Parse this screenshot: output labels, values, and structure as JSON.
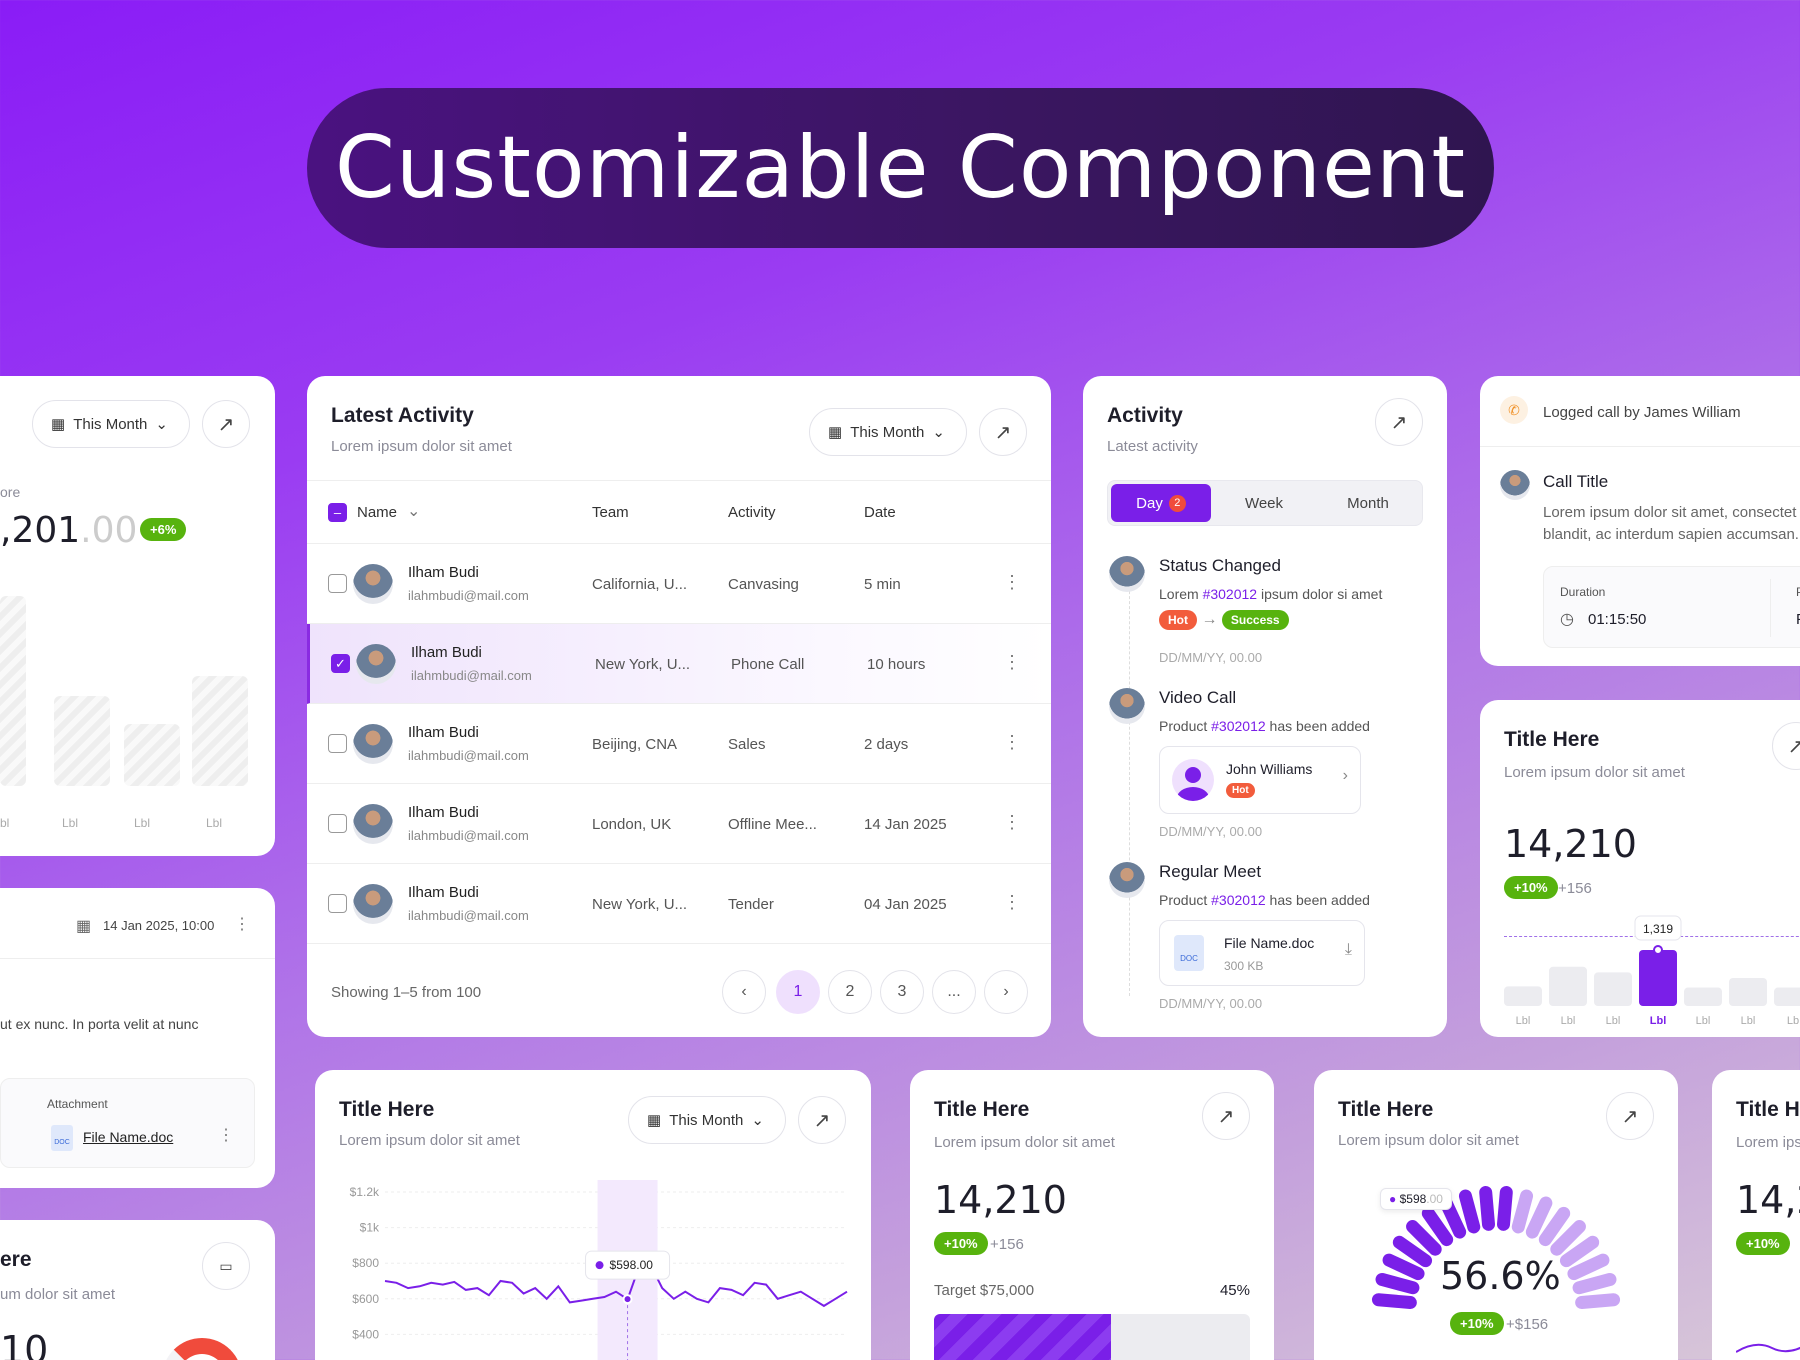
{
  "hero": {
    "title": "Customizable Component"
  },
  "left_top": {
    "filter": "This Month",
    "label_fragment": "ore",
    "value_main": ",201",
    "value_dec": ".00",
    "change": "+6%",
    "xlabels": [
      "bl",
      "Lbl",
      "Lbl",
      "Lbl"
    ]
  },
  "left_mid": {
    "datetime": "14 Jan 2025, 10:00",
    "text": "ut ex nunc. In porta velit at nunc",
    "attachment_label": "Attachment",
    "file": "File Name.doc"
  },
  "left_bot": {
    "title_fragment": "ere",
    "sub_fragment": "um dolor sit amet",
    "value_fragment": "10"
  },
  "latest": {
    "title": "Latest Activity",
    "subtitle": "Lorem ipsum dolor sit amet",
    "filter": "This Month",
    "columns": {
      "name": "Name",
      "team": "Team",
      "activity": "Activity",
      "date": "Date"
    },
    "rows": [
      {
        "name": "Ilham Budi",
        "email": "ilahmbudi@mail.com",
        "team": "California, U...",
        "activity": "Canvasing",
        "date": "5 min",
        "checked": false
      },
      {
        "name": "Ilham Budi",
        "email": "ilahmbudi@mail.com",
        "team": "New York, U...",
        "activity": "Phone Call",
        "date": "10 hours",
        "checked": true
      },
      {
        "name": "Ilham Budi",
        "email": "ilahmbudi@mail.com",
        "team": "Beijing, CNA",
        "activity": "Sales",
        "date": "2 days",
        "checked": false
      },
      {
        "name": "Ilham Budi",
        "email": "ilahmbudi@mail.com",
        "team": "London, UK",
        "activity": "Offline Mee...",
        "date": "14 Jan 2025",
        "checked": false
      },
      {
        "name": "Ilham Budi",
        "email": "ilahmbudi@mail.com",
        "team": "New York, U...",
        "activity": "Tender",
        "date": "04 Jan 2025",
        "checked": false
      }
    ],
    "showing": "Showing 1–5 from 100",
    "pages": [
      "1",
      "2",
      "3",
      "..."
    ]
  },
  "activity": {
    "title": "Activity",
    "subtitle": "Latest activity",
    "tabs": {
      "day": "Day",
      "day_badge": "2",
      "week": "Week",
      "month": "Month"
    },
    "e1": {
      "title": "Status Changed",
      "pre": "Lorem ",
      "ref": "#302012",
      "post": " ipsum dolor si amet",
      "from": "Hot",
      "to": "Success",
      "time": "DD/MM/YY, 00.00"
    },
    "e2": {
      "title": "Video Call",
      "pre": "Product ",
      "ref": "#302012",
      "post": " has been added",
      "person": "John Williams",
      "person_tag": "Hot",
      "time": "DD/MM/YY, 00.00"
    },
    "e3": {
      "title": "Regular Meet",
      "pre": "Product ",
      "ref": "#302012",
      "post": " has been added",
      "file": "File Name.doc",
      "size": "300 KB",
      "time": "DD/MM/YY, 00.00"
    }
  },
  "call": {
    "logged": "Logged call by James William",
    "title": "Call Title",
    "desc1": "Lorem ipsum dolor sit amet, consectet",
    "desc2": "blandit, ac interdum sapien accumsan.",
    "duration_label": "Duration",
    "duration": "01:15:50",
    "p_label": "P",
    "p_value": "F"
  },
  "bars": {
    "title": "Title Here",
    "subtitle": "Lorem ipsum dolor sit amet",
    "value": "14,210",
    "change": "+10%",
    "delta": "+156",
    "tooltip": "1,319",
    "labels": [
      "Lbl",
      "Lbl",
      "Lbl",
      "Lbl",
      "Lbl",
      "Lbl",
      "Lb"
    ],
    "levels": [
      0.35,
      0.7,
      0.6,
      1.0,
      0.33,
      0.5,
      0.33
    ],
    "active_index": 3
  },
  "line": {
    "title": "Title Here",
    "subtitle": "Lorem ipsum dolor sit amet",
    "filter": "This Month",
    "tooltip_main": "$598",
    "tooltip_dec": ".00"
  },
  "chart_data": {
    "type": "line",
    "yticks": [
      "$1.2k",
      "$1k",
      "$800",
      "$600",
      "$400",
      "$200"
    ],
    "ylim": [
      200,
      1200
    ],
    "x": [
      0,
      1,
      2,
      3,
      4,
      5,
      6,
      7,
      8,
      9,
      10,
      11,
      12,
      13,
      14,
      15,
      16,
      17,
      18,
      19,
      20,
      21,
      22,
      23,
      24,
      25,
      26,
      27,
      28,
      29,
      30,
      31,
      32,
      33,
      34,
      35,
      36,
      37,
      38,
      39,
      40
    ],
    "series": [
      {
        "values": [
          700,
          690,
          660,
          670,
          690,
          680,
          695,
          650,
          660,
          620,
          700,
          690,
          630,
          660,
          600,
          670,
          580,
          590,
          600,
          610,
          640,
          598,
          780,
          790,
          660,
          600,
          640,
          600,
          580,
          660,
          650,
          620,
          690,
          680,
          600,
          620,
          640,
          600,
          560,
          600,
          640
        ]
      }
    ],
    "highlight_index": 21
  },
  "target": {
    "title": "Title Here",
    "subtitle": "Lorem ipsum dolor sit amet",
    "value": "14,210",
    "change": "+10%",
    "delta": "+156",
    "target_label": "Target $75,000",
    "percent": "45%",
    "progress": 0.56
  },
  "gauge": {
    "title": "Title Here",
    "subtitle": "Lorem ipsum dolor sit amet",
    "tooltip_main": "$598",
    "tooltip_dec": ".00",
    "value": "56.6%",
    "change": "+10%",
    "delta": "+$156",
    "fill": 0.566
  },
  "right_bot": {
    "title_fragment": "Title He",
    "sub_fragment": "Lorem ips",
    "value_fragment": "14,2",
    "change": "+10%"
  },
  "colors": {
    "accent": "#7a1fe8",
    "green": "#57b30e",
    "red": "#f25c3c"
  }
}
